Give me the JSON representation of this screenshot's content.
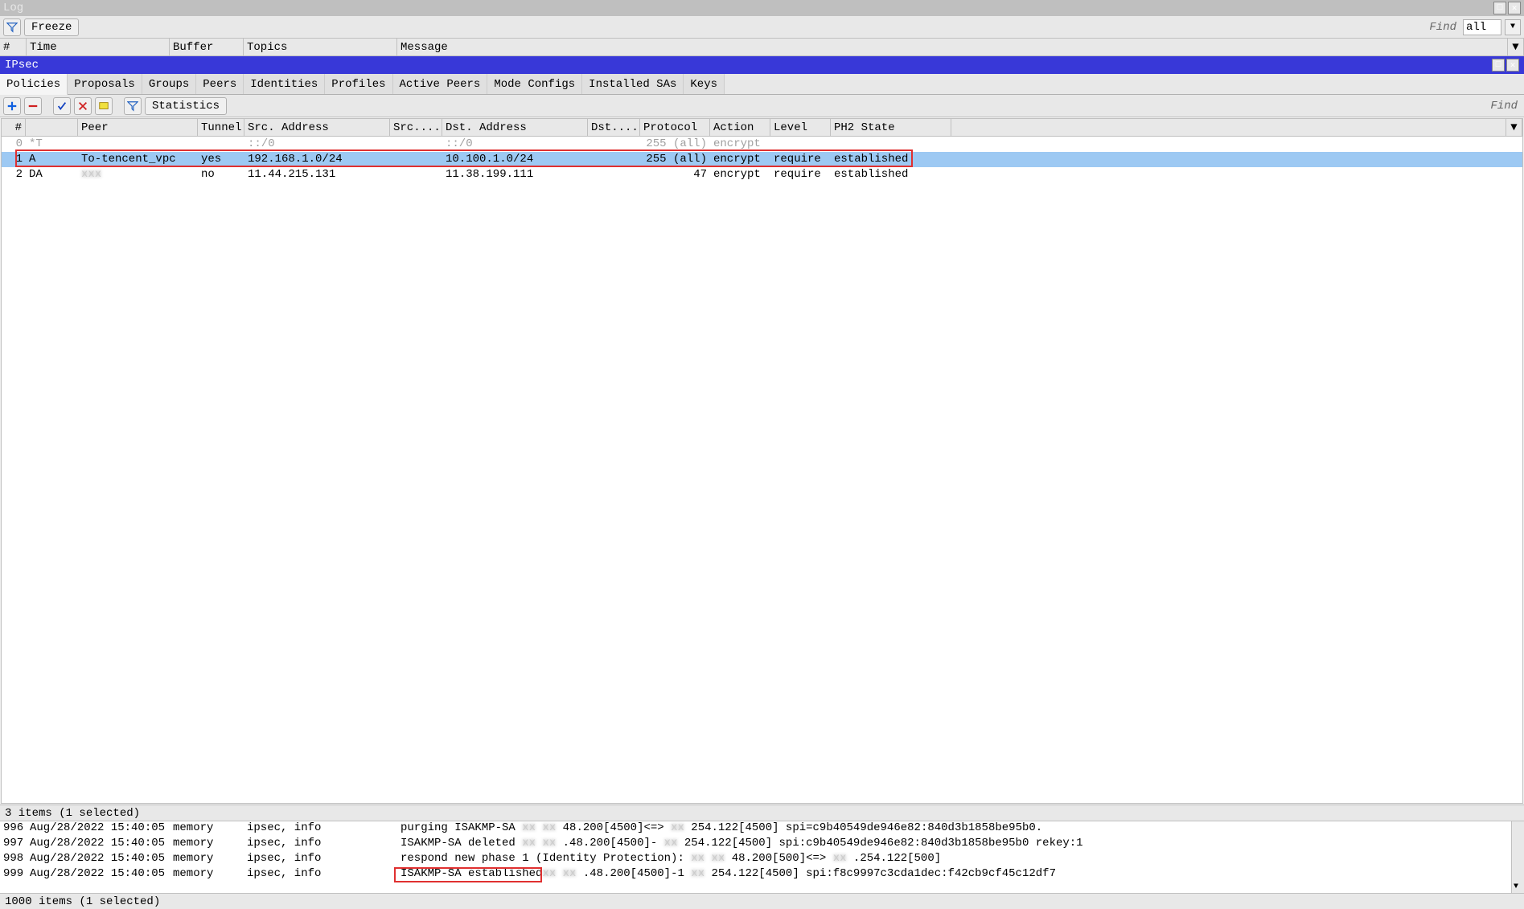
{
  "log_window": {
    "title": "Log",
    "freeze_label": "Freeze",
    "find_label": "Find",
    "find_value": "all",
    "columns": [
      "#",
      "Time",
      "Buffer",
      "Topics",
      "Message"
    ]
  },
  "ipsec_window": {
    "title": "IPsec",
    "tabs": [
      "Policies",
      "Proposals",
      "Groups",
      "Peers",
      "Identities",
      "Profiles",
      "Active Peers",
      "Mode Configs",
      "Installed SAs",
      "Keys"
    ],
    "active_tab": 0,
    "statistics_label": "Statistics",
    "find_label": "Find",
    "columns": [
      "#",
      "",
      "Peer",
      "Tunnel",
      "Src. Address",
      "Src....",
      "Dst. Address",
      "Dst....",
      "Protocol",
      "Action",
      "Level",
      "PH2 State"
    ],
    "rows": [
      {
        "n": "0",
        "flag": "*T",
        "peer": "",
        "tunnel": "",
        "src": "::/0",
        "srcp": "",
        "dst": "::/0",
        "dstp": "",
        "proto": "255 (all)",
        "action": "encrypt",
        "level": "",
        "ph2": "",
        "dim": true,
        "sel": false
      },
      {
        "n": "1",
        "flag": "A",
        "peer": "To-tencent_vpc",
        "tunnel": "yes",
        "src": "192.168.1.0/24",
        "srcp": "",
        "dst": "10.100.1.0/24",
        "dstp": "",
        "proto": "255 (all)",
        "action": "encrypt",
        "level": "require",
        "ph2": "established",
        "dim": false,
        "sel": true
      },
      {
        "n": "2",
        "flag": "DA",
        "peer": "",
        "tunnel": "no",
        "src": "11.44.215.131",
        "srcp": "",
        "dst": "11.38.199.111",
        "dstp": "",
        "proto": "47",
        "action": "encrypt",
        "level": "require",
        "ph2": "established",
        "dim": false,
        "sel": false,
        "peer_blur": true
      }
    ],
    "status": "3 items (1 selected)"
  },
  "log_entries": [
    {
      "n": "996",
      "time": "Aug/28/2022 15:40:05",
      "buffer": "memory",
      "topics": "ipsec, info",
      "msg_pre": "purging ISAKMP-SA ",
      "msg_mid": "48.200[4500]<=>",
      "msg_post": "254.122[4500] spi=c9b40549de946e82:840d3b1858be95b0."
    },
    {
      "n": "997",
      "time": "Aug/28/2022 15:40:05",
      "buffer": "memory",
      "topics": "ipsec, info",
      "msg_pre": "ISAKMP-SA deleted ",
      "msg_mid": ".48.200[4500]-",
      "msg_post": "254.122[4500] spi:c9b40549de946e82:840d3b1858be95b0 rekey:1"
    },
    {
      "n": "998",
      "time": "Aug/28/2022 15:40:05",
      "buffer": "memory",
      "topics": "ipsec, info",
      "msg_pre": "respond new phase 1 (Identity Protection): ",
      "msg_mid": "48.200[500]<=>",
      "msg_post": ".254.122[500]"
    },
    {
      "n": "999",
      "time": "Aug/28/2022 15:40:05",
      "buffer": "memory",
      "topics": "ipsec, info",
      "msg_pre": "ISAKMP-SA established",
      "msg_mid": ".48.200[4500]-1",
      "msg_post": "254.122[4500] spi:f8c9997c3cda1dec:f42cb9cf45c12df7",
      "box": true
    }
  ],
  "log_status": "1000 items (1 selected)"
}
